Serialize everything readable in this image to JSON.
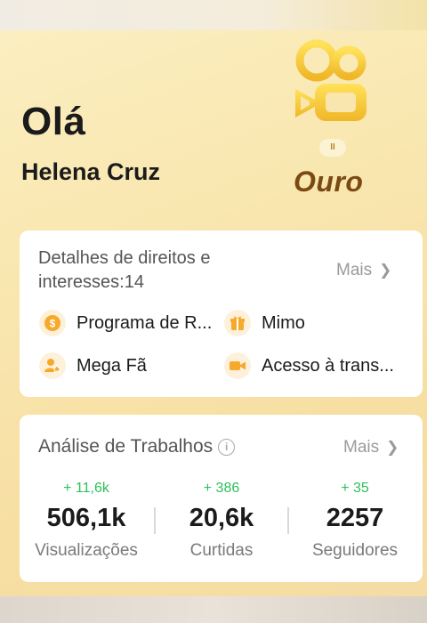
{
  "header": {
    "greeting": "Olá",
    "username": "Helena Cruz"
  },
  "membership": {
    "level_marker": "II",
    "tier_label": "Ouro",
    "accent_color": "#f2c335",
    "tier_text_color": "#7a4a12"
  },
  "rights": {
    "title": "Detalhes de direitos e interesses:14",
    "more_label": "Mais",
    "items": [
      {
        "label": "Programa de R...",
        "icon": "coin-icon"
      },
      {
        "label": "Mimo",
        "icon": "gift-icon"
      },
      {
        "label": "Mega Fã",
        "icon": "fan-icon"
      },
      {
        "label": "Acesso à trans...",
        "icon": "video-camera-icon"
      }
    ]
  },
  "works": {
    "title": "Análise de Trabalhos",
    "more_label": "Mais",
    "stats": [
      {
        "delta": "+ 11,6k",
        "value": "506,1k",
        "label": "Visualizações"
      },
      {
        "delta": "+ 386",
        "value": "20,6k",
        "label": "Curtidas"
      },
      {
        "delta": "+ 35",
        "value": "2257",
        "label": "Seguidores"
      }
    ],
    "delta_color": "#2ec05b"
  }
}
